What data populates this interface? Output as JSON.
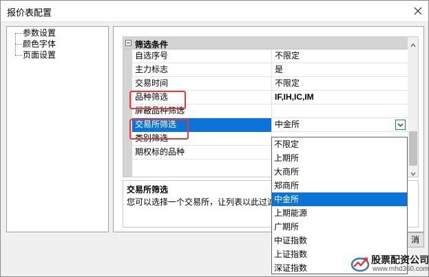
{
  "window": {
    "title": "报价表配置",
    "close_icon": "close-icon"
  },
  "tree": {
    "items": [
      {
        "label": "参数设置"
      },
      {
        "label": "颜色字体"
      },
      {
        "label": "页面设置"
      }
    ]
  },
  "property_grid": {
    "group": {
      "label": "筛选条件",
      "toggle_icon": "collapse-icon"
    },
    "rows": [
      {
        "name": "自选序号",
        "value": "不限定"
      },
      {
        "name": "主力标志",
        "value": "是"
      },
      {
        "name": "交易时间",
        "value": "不限定"
      },
      {
        "name": "品种筛选",
        "value": "IF,IH,IC,IM"
      },
      {
        "name": "屏蔽品种筛选",
        "value": ""
      },
      {
        "name": "交易所筛选",
        "value": "中金所"
      },
      {
        "name": "类别筛选",
        "value": ""
      },
      {
        "name": "期权标的品种",
        "value": ""
      }
    ],
    "selected_row": "交易所筛选",
    "combo_icon": "chevron-down-icon"
  },
  "description": {
    "title": "交易所筛选",
    "text": "您可以选择一个交易所，让列表以此过滤"
  },
  "dropdown": {
    "options": [
      "不限定",
      "上期所",
      "大商所",
      "郑商所",
      "中金所",
      "上期能源",
      "广期所",
      "中证指数",
      "上证指数",
      "深证指数"
    ],
    "selected": "中金所"
  },
  "buttons": {
    "cancel_visible_text": "消"
  },
  "watermark": {
    "title": "股票配资公司",
    "url": "www.mhd360.com"
  },
  "colors": {
    "selection": "#0a74d9",
    "highlight_box": "#e53935"
  }
}
